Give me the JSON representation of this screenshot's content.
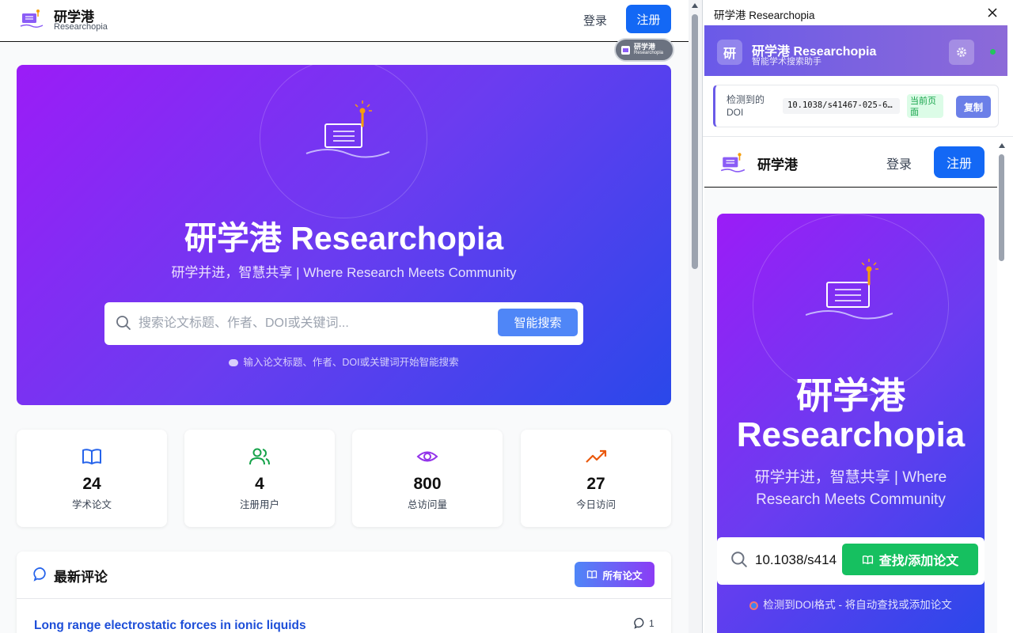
{
  "header": {
    "brand_cn": "研学港",
    "brand_en": "Researchopia",
    "login": "登录",
    "signup": "注册"
  },
  "float_badge": {
    "cn": "研学港",
    "en": "Researchopia"
  },
  "hero": {
    "title": "研学港 Researchopia",
    "subtitle": "研学并进，智慧共享 | Where Research Meets Community",
    "search_placeholder": "搜索论文标题、作者、DOI或关键词...",
    "search_button": "智能搜索",
    "hint": "输入论文标题、作者、DOI或关键词开始智能搜索"
  },
  "stats": [
    {
      "value": "24",
      "label": "学术论文",
      "icon": "book-open-icon",
      "color": "#2563eb"
    },
    {
      "value": "4",
      "label": "注册用户",
      "icon": "users-icon",
      "color": "#16a34a"
    },
    {
      "value": "800",
      "label": "总访问量",
      "icon": "eye-icon",
      "color": "#9333ea"
    },
    {
      "value": "27",
      "label": "今日访问",
      "icon": "trending-up-icon",
      "color": "#ea580c"
    }
  ],
  "comments": {
    "title": "最新评论",
    "all_papers": "所有论文",
    "items": [
      {
        "title": "Long range electrostatic forces in ionic liquids",
        "count": "1"
      }
    ]
  },
  "panel": {
    "title": "研学港 Researchopia",
    "ext_logo": "研",
    "ext_name": "研学港 Researchopia",
    "ext_sub": "智能学术搜索助手",
    "doi_label": "检测到的DOI",
    "doi_value": "10.1038/s41467-025-6…",
    "doi_tag": "当前页面",
    "copy": "复制"
  },
  "mini": {
    "brand": "研学港",
    "login": "登录",
    "signup": "注册",
    "title_cn": "研学港",
    "title_en": "Researchopia",
    "subtitle": "研学并进，智慧共享 | Where Research Meets Community",
    "search_value": "10.1038/s414",
    "find_button": "查找/添加论文",
    "hint": "检测到DOI格式 - 将自动查找或添加论文"
  },
  "colors": {
    "accent_blue": "#1368f5",
    "hero_start": "#9b1cf7",
    "hero_end": "#2a48ea",
    "find_green": "#16c060"
  }
}
